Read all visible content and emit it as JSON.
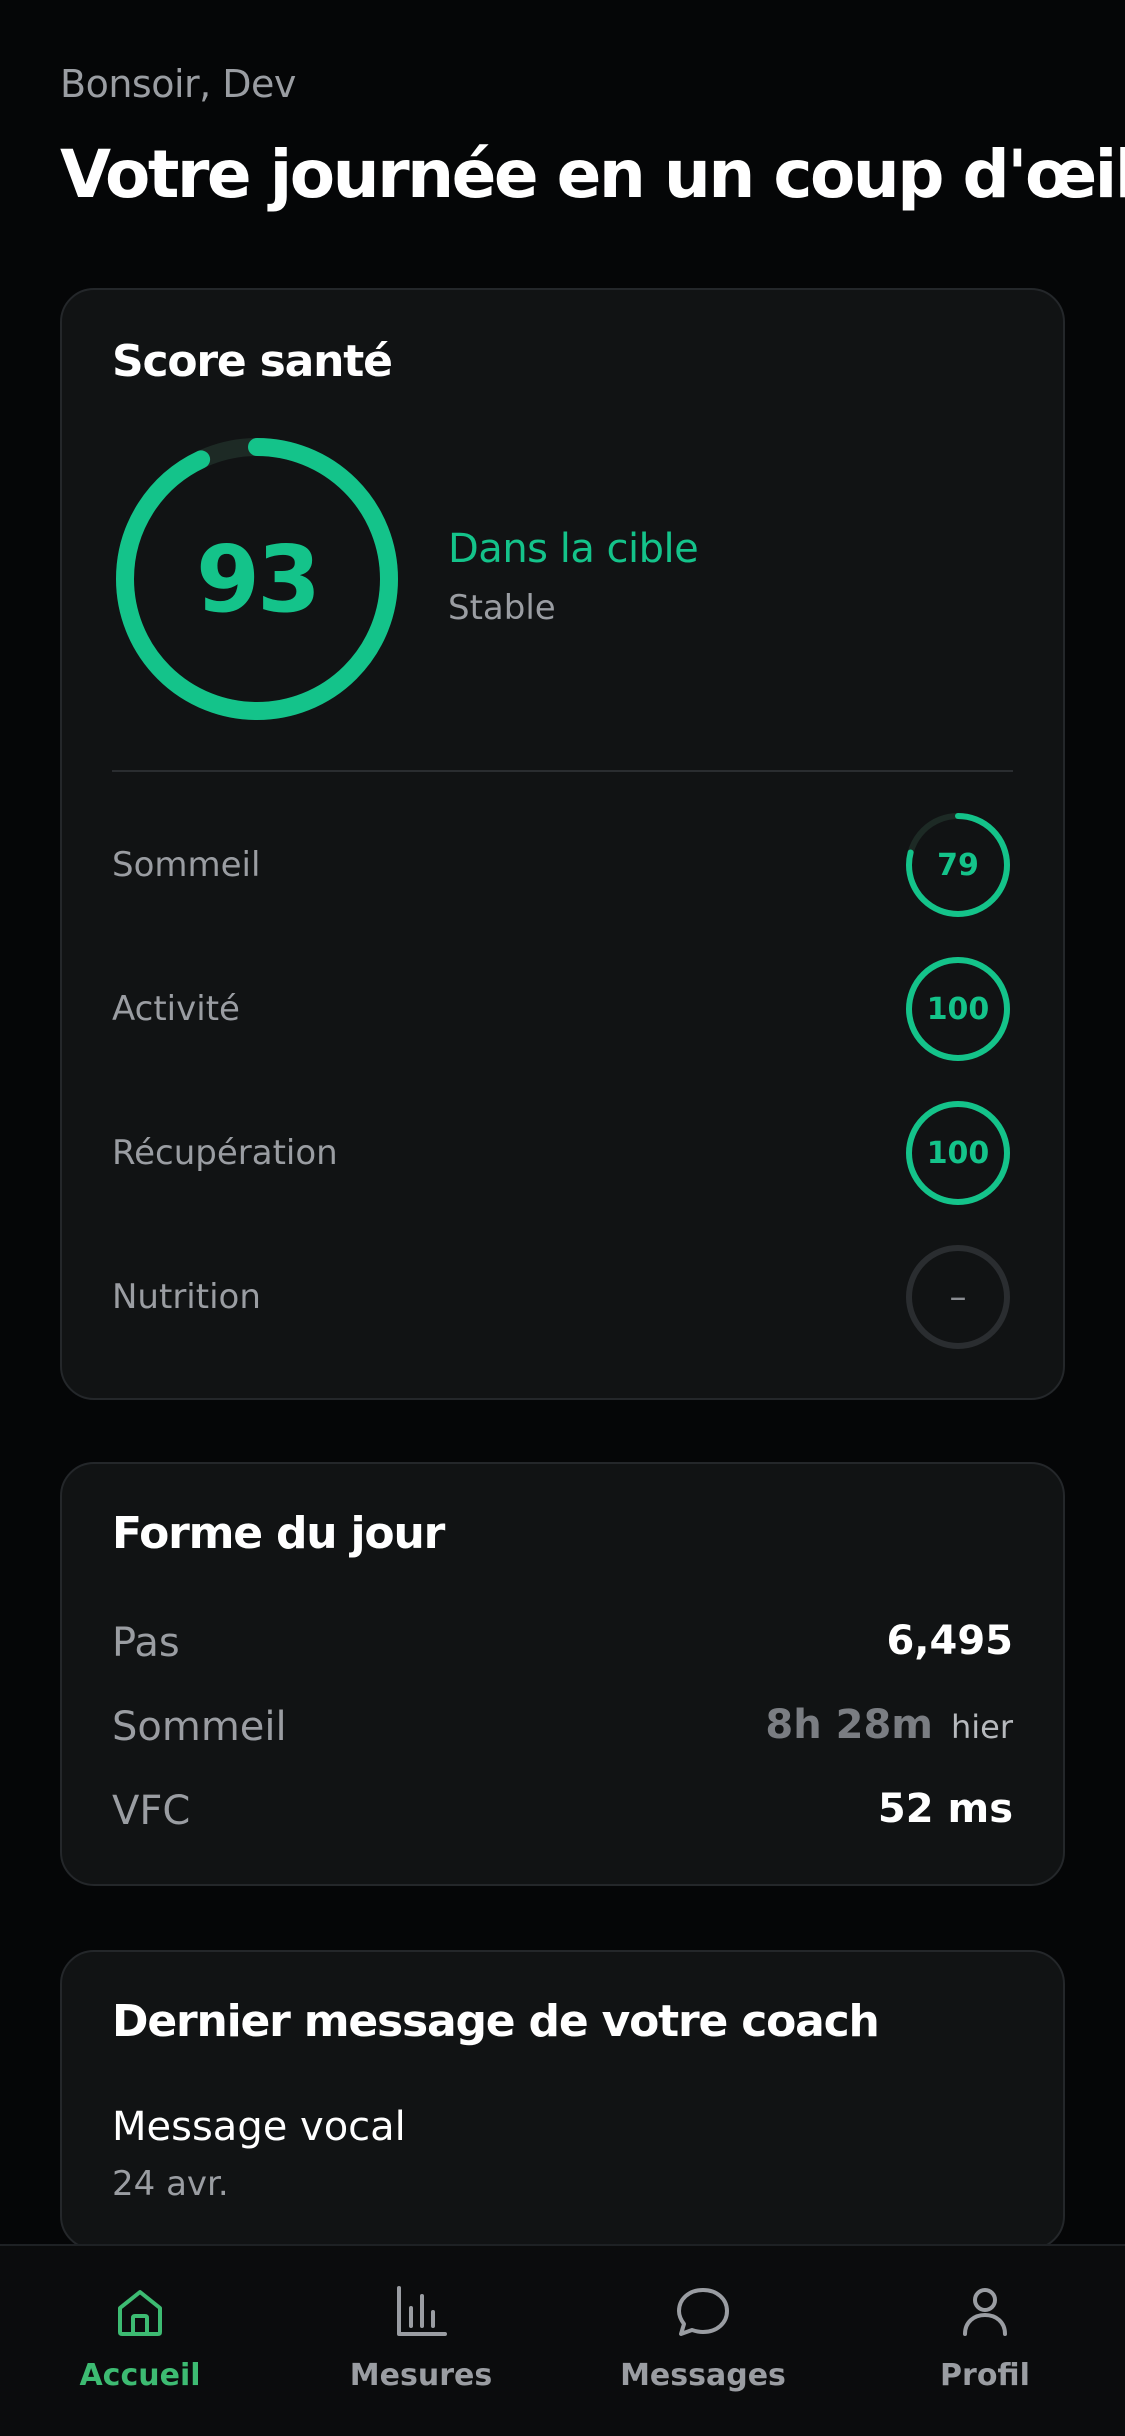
{
  "header": {
    "greeting": "Bonsoir, Dev",
    "title": "Votre journée en un coup d'œil"
  },
  "score_card": {
    "title": "Score santé",
    "score": "93",
    "score_fraction": 0.93,
    "status": "Dans la cible",
    "trend": "Stable",
    "metrics": [
      {
        "label": "Sommeil",
        "value": "79",
        "fraction": 0.79
      },
      {
        "label": "Activité",
        "value": "100",
        "fraction": 1.0
      },
      {
        "label": "Récupération",
        "value": "100",
        "fraction": 1.0
      },
      {
        "label": "Nutrition",
        "value": "–",
        "fraction": 0
      }
    ]
  },
  "forme_card": {
    "title": "Forme du jour",
    "rows": [
      {
        "label": "Pas",
        "value": "6,495",
        "suffix": ""
      },
      {
        "label": "Sommeil",
        "value": "8h 28m",
        "suffix": "hier"
      },
      {
        "label": "VFC",
        "value": "52 ms",
        "suffix": ""
      }
    ]
  },
  "coach_card": {
    "title": "Dernier message de votre coach",
    "message_type": "Message vocal",
    "date": "24 avr."
  },
  "nav": {
    "items": [
      {
        "label": "Accueil",
        "icon": "home-icon",
        "active": true
      },
      {
        "label": "Mesures",
        "icon": "bar-chart-icon",
        "active": false
      },
      {
        "label": "Messages",
        "icon": "chat-bubble-icon",
        "active": false
      },
      {
        "label": "Profil",
        "icon": "user-icon",
        "active": false
      }
    ]
  },
  "colors": {
    "accent": "#14c38a",
    "nav_active": "#3dbb72",
    "background": "#050607",
    "card": "#111314",
    "ring_track": "#1d2a25",
    "ring_empty": "#2a2d30"
  }
}
